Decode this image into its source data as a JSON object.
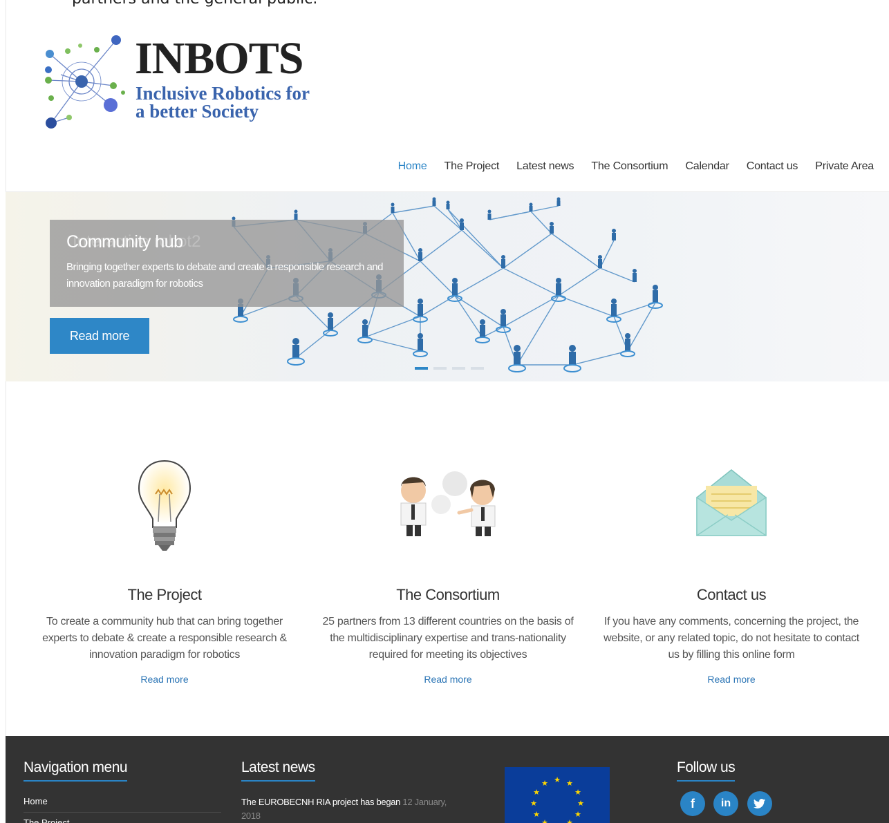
{
  "top_text": "partners and the general public.",
  "logo": {
    "title": "INBOTS",
    "subtitle_line1": "Inclusive Robotics for",
    "subtitle_line2": "a better Society"
  },
  "nav": {
    "items": [
      "Home",
      "The Project",
      "Latest news",
      "The Consortium",
      "Calendar",
      "Contact us",
      "Private Area"
    ],
    "active": "Home"
  },
  "hero": {
    "ghost_text": "Interactive robot2",
    "title": "Community hub",
    "text": "Bringing together experts to debate and create a responsible research and innovation paradigm for robotics",
    "button": "Read more"
  },
  "features": [
    {
      "icon": "lightbulb-icon",
      "title": "The Project",
      "text": "To create a community hub that can bring together experts to debate & create a responsible research & innovation paradigm for robotics",
      "link": "Read more"
    },
    {
      "icon": "people-talking-icon",
      "title": "The Consortium",
      "text": "25 partners from 13 different countries on the basis of the multidisciplinary expertise and trans-nationality required for meeting its objectives",
      "link": "Read more"
    },
    {
      "icon": "envelope-icon",
      "title": "Contact us",
      "text": "If you have any comments, concerning the project, the website, or any related topic, do not hesitate to contact us by filling this online form",
      "link": "Read more"
    }
  ],
  "footer": {
    "nav_heading": "Navigation menu",
    "nav_links": [
      "Home",
      "The Project"
    ],
    "news_heading": "Latest news",
    "news_item_title": "The EUROBECNH RIA project has began",
    "news_item_date": "12 January, 2018",
    "follow_heading": "Follow us",
    "social": [
      "f",
      "in",
      "t"
    ]
  },
  "colors": {
    "accent": "#2a84c6",
    "button": "#2e87c7",
    "footer_bg": "#333333",
    "logo_blue": "#3a64ad"
  }
}
